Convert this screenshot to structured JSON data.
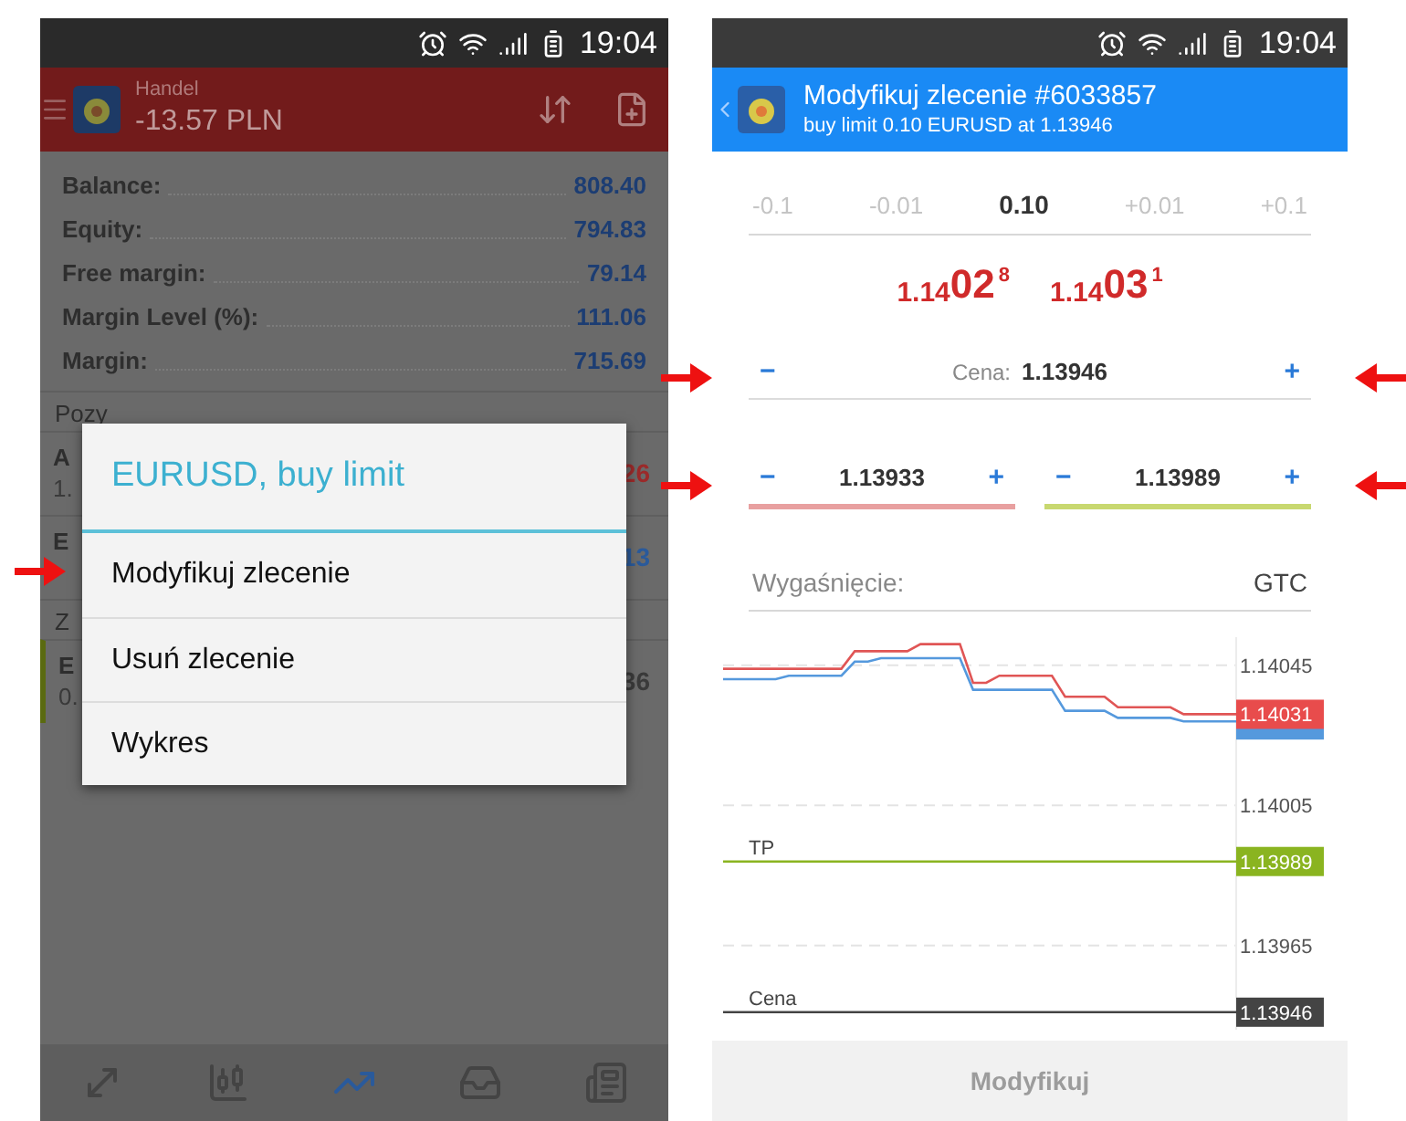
{
  "left_screen": {
    "status_bar": {
      "time": "19:04"
    },
    "header": {
      "title": "Handel",
      "profit": "-13.57 PLN"
    },
    "account": [
      {
        "label": "Balance:",
        "value": "808.40"
      },
      {
        "label": "Equity:",
        "value": "794.83"
      },
      {
        "label": "Free margin:",
        "value": "79.14"
      },
      {
        "label": "Margin Level (%):",
        "value": "111.06"
      },
      {
        "label": "Margin:",
        "value": "715.69"
      }
    ],
    "background_rows": [
      {
        "kind": "section",
        "text": "Pozy"
      },
      {
        "kind": "row",
        "symbol": "A",
        "sub": "1.",
        "value": "26",
        "color": "#9b2a2a",
        "selected": false
      },
      {
        "kind": "row",
        "symbol": "E",
        "value": "13",
        "color": "#2a5a9b",
        "selected": false
      },
      {
        "kind": "section",
        "text": "Z"
      },
      {
        "kind": "row",
        "symbol": "E",
        "sub": "0.",
        "value": "36",
        "color": "#3a3a3a",
        "selected": true
      }
    ],
    "dialog": {
      "title": "EURUSD, buy limit",
      "items": [
        "Modyfikuj zlecenie",
        "Usuń zlecenie",
        "Wykres"
      ]
    },
    "bottom_nav": [
      {
        "selected": false
      },
      {
        "selected": false
      },
      {
        "selected": true
      },
      {
        "selected": false
      },
      {
        "selected": false
      }
    ]
  },
  "right_screen": {
    "status_bar": {
      "time": "19:04"
    },
    "header": {
      "title": "Modyfikuj zlecenie #6033857",
      "subtitle": "buy limit 0.10 EURUSD at 1.13946"
    },
    "volume_steps": [
      {
        "text": "-0.1",
        "selected": false
      },
      {
        "text": "-0.01",
        "selected": false
      },
      {
        "text": "0.10",
        "selected": true
      },
      {
        "text": "+0.01",
        "selected": false
      },
      {
        "text": "+0.1",
        "selected": false
      }
    ],
    "quotes": [
      {
        "prefix": "1.14",
        "big": "02",
        "sup": "8"
      },
      {
        "prefix": "1.14",
        "big": "03",
        "sup": "1"
      }
    ],
    "price_field": {
      "label": "Cena:",
      "value": "1.13946",
      "minus": "−",
      "plus": "+"
    },
    "sl_tp": [
      {
        "value": "1.13933",
        "minus": "−",
        "plus": "+",
        "color": "#e8a0a0"
      },
      {
        "value": "1.13989",
        "minus": "−",
        "plus": "+",
        "color": "#c8d870"
      }
    ],
    "expiration": {
      "label": "Wygaśnięcie:",
      "value": "GTC"
    },
    "chart_data": {
      "type": "line",
      "grid": true,
      "ylim": [
        1.13941,
        1.14053
      ],
      "yticks": [
        1.13965,
        1.14005,
        1.14045
      ],
      "series": [
        {
          "color": "#e05555",
          "values": [
            1.14044,
            1.14044,
            1.14044,
            1.14044,
            1.14044,
            1.14044,
            1.14044,
            1.14044,
            1.14044,
            1.14044,
            1.14049,
            1.14049,
            1.14049,
            1.14049,
            1.14049,
            1.14051,
            1.14051,
            1.14051,
            1.14051,
            1.1404,
            1.1404,
            1.14042,
            1.14042,
            1.14042,
            1.14042,
            1.14042,
            1.14036,
            1.14036,
            1.14036,
            1.14036,
            1.14033,
            1.14033,
            1.14033,
            1.14033,
            1.14033,
            1.14031,
            1.14031,
            1.14031,
            1.14031,
            1.14031
          ]
        },
        {
          "color": "#5599dd",
          "values": [
            1.14041,
            1.14041,
            1.14041,
            1.14041,
            1.14041,
            1.14042,
            1.14042,
            1.14042,
            1.14042,
            1.14042,
            1.14046,
            1.14046,
            1.14047,
            1.14047,
            1.14047,
            1.14047,
            1.14047,
            1.14047,
            1.14047,
            1.14038,
            1.14038,
            1.14038,
            1.14038,
            1.14038,
            1.14038,
            1.14038,
            1.14032,
            1.14032,
            1.14032,
            1.14032,
            1.1403,
            1.1403,
            1.1403,
            1.1403,
            1.1403,
            1.14029,
            1.14029,
            1.14029,
            1.14029,
            1.14029
          ]
        },
        {
          "name": "TP",
          "color": "#8ab420",
          "values": [
            1.13989,
            1.13989,
            1.13989,
            1.13989,
            1.13989,
            1.13989,
            1.13989,
            1.13989,
            1.13989,
            1.13989,
            1.13989,
            1.13989,
            1.13989,
            1.13989,
            1.13989,
            1.13989,
            1.13989,
            1.13989,
            1.13989,
            1.13989,
            1.13989,
            1.13989,
            1.13989,
            1.13989,
            1.13989,
            1.13989,
            1.13989,
            1.13989,
            1.13989,
            1.13989,
            1.13989,
            1.13989,
            1.13989,
            1.13989,
            1.13989,
            1.13989,
            1.13989,
            1.13989,
            1.13989,
            1.13989
          ]
        },
        {
          "name": "Cena",
          "color": "#444444",
          "values": [
            1.13946,
            1.13946,
            1.13946,
            1.13946,
            1.13946,
            1.13946,
            1.13946,
            1.13946,
            1.13946,
            1.13946,
            1.13946,
            1.13946,
            1.13946,
            1.13946,
            1.13946,
            1.13946,
            1.13946,
            1.13946,
            1.13946,
            1.13946,
            1.13946,
            1.13946,
            1.13946,
            1.13946,
            1.13946,
            1.13946,
            1.13946,
            1.13946,
            1.13946,
            1.13946,
            1.13946,
            1.13946,
            1.13946,
            1.13946,
            1.13946,
            1.13946,
            1.13946,
            1.13946,
            1.13946,
            1.13946
          ]
        }
      ]
    },
    "price_tags": [
      {
        "text": "1.14031",
        "color": "#e84c4c"
      },
      {
        "text": "1.13989",
        "color": "#8ab420"
      },
      {
        "text": "1.13946",
        "color": "#444444"
      }
    ],
    "submit": {
      "label": "Modyfikuj",
      "disabled": true
    }
  },
  "annotation_arrows": [
    {
      "kind": "right"
    },
    {
      "kind": "left"
    },
    {
      "kind": "right"
    },
    {
      "kind": "left"
    },
    {
      "kind": "right"
    }
  ]
}
